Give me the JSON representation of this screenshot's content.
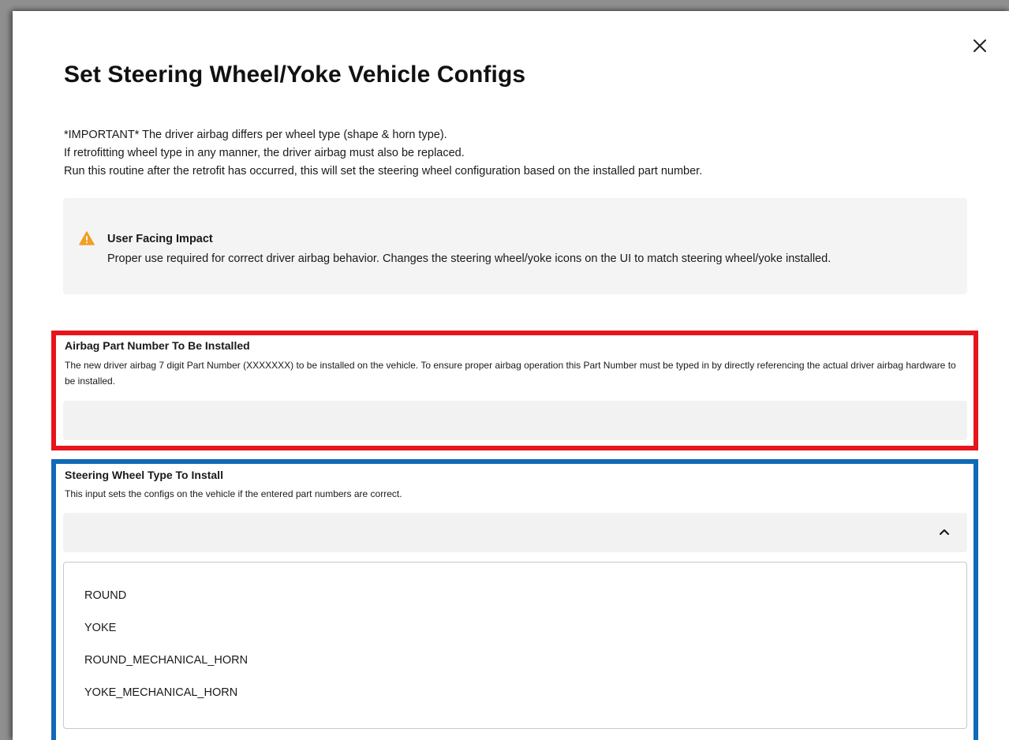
{
  "dialog": {
    "title": "Set Steering Wheel/Yoke Vehicle Configs",
    "intro_lines": [
      "*IMPORTANT* The driver airbag differs per wheel type (shape & horn type).",
      "If retrofitting wheel type in any manner, the driver airbag must also be replaced.",
      "Run this routine after the retrofit has occurred, this will set the steering wheel configuration based on the installed part number."
    ],
    "close_icon": "close-icon"
  },
  "impact": {
    "icon": "warning-icon",
    "icon_color": "#f0a020",
    "title": "User Facing Impact",
    "text": "Proper use required for correct driver airbag behavior. Changes the steering wheel/yoke icons on the UI to match steering wheel/yoke installed."
  },
  "airbag_field": {
    "label": "Airbag Part Number To Be Installed",
    "description": "The new driver airbag 7 digit Part Number (XXXXXXX) to be installed on the vehicle. To ensure proper airbag operation this Part Number must be typed in by directly referencing the actual driver airbag hardware to be installed.",
    "value": "",
    "highlight_color": "#e8141b"
  },
  "wheel_field": {
    "label": "Steering Wheel Type To Install",
    "description": "This input sets the configs on the vehicle if the entered part numbers are correct.",
    "selected_value": "",
    "expanded": true,
    "chevron_icon": "chevron-up-icon",
    "highlight_color": "#1169b8",
    "options": [
      "ROUND",
      "YOKE",
      "ROUND_MECHANICAL_HORN",
      "YOKE_MECHANICAL_HORN"
    ]
  }
}
